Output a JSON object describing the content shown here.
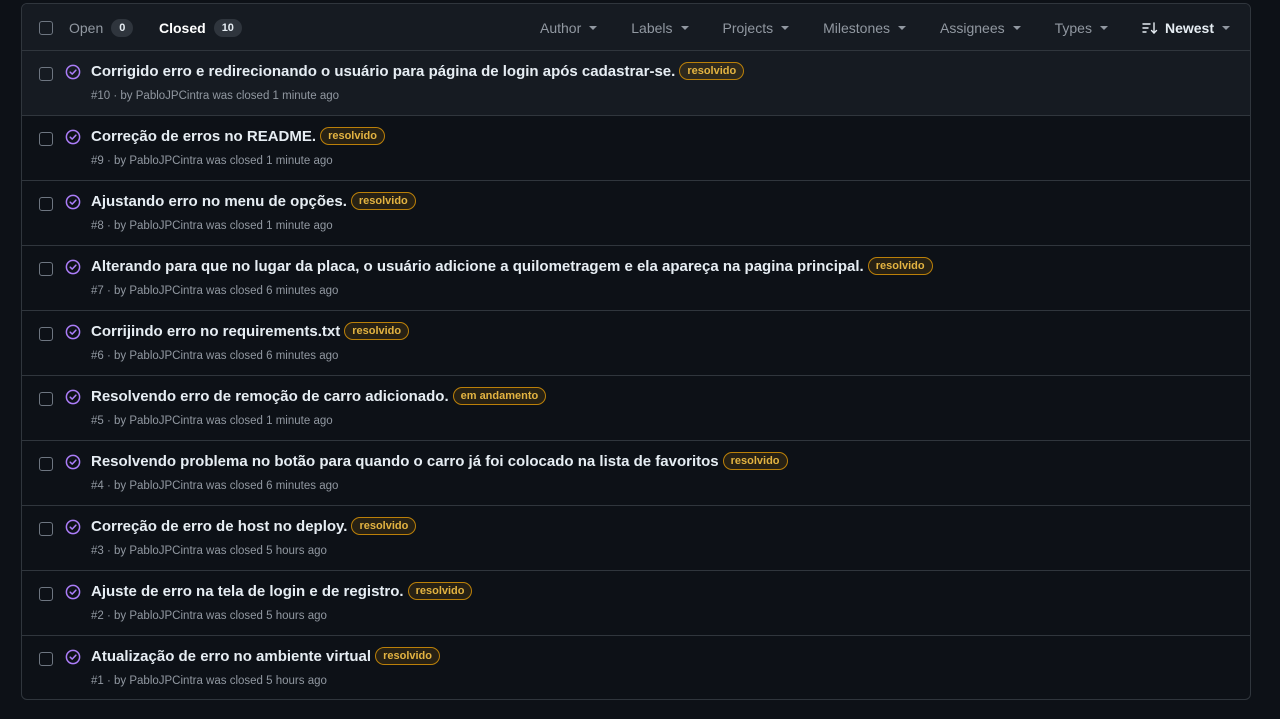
{
  "header": {
    "open_label": "Open",
    "open_count": "0",
    "closed_label": "Closed",
    "closed_count": "10",
    "filters": [
      "Author",
      "Labels",
      "Projects",
      "Milestones",
      "Assignees",
      "Types"
    ],
    "sort_label": "Newest"
  },
  "colors": {
    "label_border": "#bb8009",
    "label_text": "#e3b341",
    "closed_icon": "#ab7df8"
  },
  "issues": [
    {
      "title": "Corrigido erro e redirecionando o usuário para página de login após cadastrar-se.",
      "label": "resolvido",
      "meta": "#10 · by PabloJPCintra was closed 1 minute ago"
    },
    {
      "title": "Correção de erros no README.",
      "label": "resolvido",
      "meta": "#9 · by PabloJPCintra was closed 1 minute ago"
    },
    {
      "title": "Ajustando erro no menu de opções.",
      "label": "resolvido",
      "meta": "#8 · by PabloJPCintra was closed 1 minute ago"
    },
    {
      "title": "Alterando para que no lugar da placa, o usuário adicione a quilometragem e ela apareça na pagina principal.",
      "label": "resolvido",
      "meta": "#7 · by PabloJPCintra was closed 6 minutes ago"
    },
    {
      "title": "Corrijindo erro no requirements.txt",
      "label": "resolvido",
      "meta": "#6 · by PabloJPCintra was closed 6 minutes ago"
    },
    {
      "title": "Resolvendo erro de remoção de carro adicionado.",
      "label": "em andamento",
      "meta": "#5 · by PabloJPCintra was closed 1 minute ago"
    },
    {
      "title": "Resolvendo problema no botão para quando o carro já foi colocado na lista de favoritos",
      "label": "resolvido",
      "meta": "#4 · by PabloJPCintra was closed 6 minutes ago"
    },
    {
      "title": "Correção de erro de host no deploy.",
      "label": "resolvido",
      "meta": "#3 · by PabloJPCintra was closed 5 hours ago"
    },
    {
      "title": "Ajuste de erro na tela de login e de registro.",
      "label": "resolvido",
      "meta": "#2 · by PabloJPCintra was closed 5 hours ago"
    },
    {
      "title": "Atualização de erro no ambiente virtual",
      "label": "resolvido",
      "meta": "#1 · by PabloJPCintra was closed 5 hours ago"
    }
  ]
}
